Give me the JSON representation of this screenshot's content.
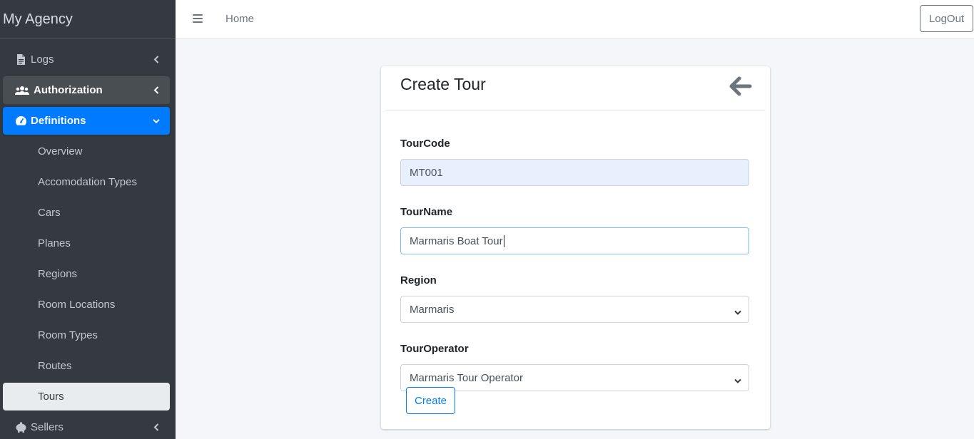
{
  "brand": {
    "title": "My Agency"
  },
  "sidebar": {
    "items": [
      {
        "label": "Logs",
        "icon": "file-icon"
      },
      {
        "label": "Authorization",
        "icon": "users-icon"
      },
      {
        "label": "Definitions",
        "icon": "dashboard-icon"
      }
    ],
    "sub_items": [
      {
        "label": "Overview"
      },
      {
        "label": "Accomodation Types"
      },
      {
        "label": "Cars"
      },
      {
        "label": "Planes"
      },
      {
        "label": "Regions"
      },
      {
        "label": "Room Locations"
      },
      {
        "label": "Room Types"
      },
      {
        "label": "Routes"
      },
      {
        "label": "Tours"
      }
    ],
    "sellers": {
      "label": "Sellers",
      "icon": "piggy-bank-icon"
    }
  },
  "header": {
    "menu_icon": "hamburger-icon",
    "home_label": "Home",
    "logout_label": "LogOut"
  },
  "card": {
    "title": "Create Tour",
    "back_icon": "arrow-left-icon"
  },
  "form": {
    "tour_code": {
      "label": "TourCode",
      "value": "MT001"
    },
    "tour_name": {
      "label": "TourName",
      "value": "Marmaris Boat Tour"
    },
    "region": {
      "label": "Region",
      "selected": "Marmaris"
    },
    "tour_operator": {
      "label": "TourOperator",
      "selected": "Marmaris Tour Operator"
    },
    "create_label": "Create"
  },
  "colors": {
    "sidebar_bg": "#343a40",
    "active_blue": "#007bff",
    "page_bg": "#f4f6f9"
  }
}
